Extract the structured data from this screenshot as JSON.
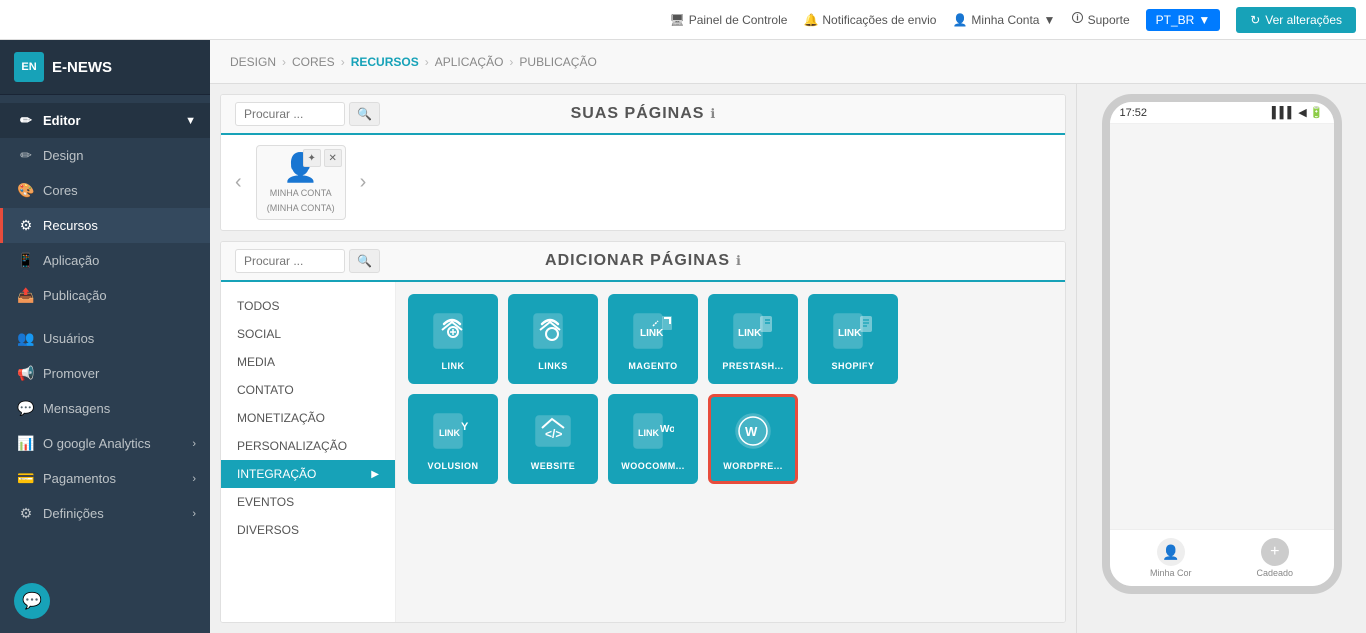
{
  "app": {
    "logo_text": "E-NEWS",
    "logo_icon": "EN"
  },
  "topbar": {
    "painel": "Painel de Controle",
    "notificacoes": "Notificações de envio",
    "minha_conta": "Minha Conta",
    "suporte": "Suporte",
    "lang": "PT_BR",
    "ver_alteracoes": "Ver alterações",
    "refresh_icon": "↻"
  },
  "breadcrumb": {
    "items": [
      "DESIGN",
      "CORES",
      "RECURSOS",
      "APLICAÇÃO",
      "PUBLICAÇÃO"
    ]
  },
  "sidebar": {
    "editor_label": "Editor",
    "items": [
      {
        "id": "design",
        "label": "Design",
        "icon": "✏"
      },
      {
        "id": "cores",
        "label": "Cores",
        "icon": "🎨"
      },
      {
        "id": "recursos",
        "label": "Recursos",
        "icon": "⚙",
        "active": true
      },
      {
        "id": "aplicacao",
        "label": "Aplicação",
        "icon": "📱"
      },
      {
        "id": "publicacao",
        "label": "Publicação",
        "icon": "📤"
      }
    ],
    "sections": [
      {
        "id": "usuarios",
        "label": "Usuários",
        "icon": "👥",
        "has_arrow": false
      },
      {
        "id": "promover",
        "label": "Promover",
        "icon": "📢",
        "has_arrow": false
      },
      {
        "id": "mensagens",
        "label": "Mensagens",
        "icon": "💬",
        "has_arrow": false
      },
      {
        "id": "analytics",
        "label": "O google Analytics",
        "icon": "📊",
        "has_arrow": true
      },
      {
        "id": "pagamentos",
        "label": "Pagamentos",
        "icon": "💳",
        "has_arrow": true
      },
      {
        "id": "definicoes",
        "label": "Definições",
        "icon": "⚙",
        "has_arrow": true
      }
    ]
  },
  "suas_paginas": {
    "title": "SUAS PÁGINAS",
    "search_placeholder": "Procurar ...",
    "search_btn": "🔍",
    "page_card": {
      "icon": "👤",
      "label": "MINHA CONTA",
      "sublabel": "(MINHA CONTA)"
    }
  },
  "adicionar_paginas": {
    "title": "ADICIONAR PÁGINAS",
    "search_placeholder": "Procurar ...",
    "search_btn": "🔍",
    "categories": [
      {
        "id": "todos",
        "label": "TODOS"
      },
      {
        "id": "social",
        "label": "SOCIAL"
      },
      {
        "id": "media",
        "label": "MEDIA"
      },
      {
        "id": "contato",
        "label": "CONTATO"
      },
      {
        "id": "monetizacao",
        "label": "MONETIZAÇÃO"
      },
      {
        "id": "personalizacao",
        "label": "PERSONALIZAÇÃO"
      },
      {
        "id": "integracao",
        "label": "INTEGRAÇÃO",
        "active": true
      },
      {
        "id": "eventos",
        "label": "EVENTOS"
      },
      {
        "id": "diversos",
        "label": "DIVERSOS"
      }
    ],
    "tiles_row1": [
      {
        "id": "link",
        "label": "LINK",
        "selected": false
      },
      {
        "id": "links",
        "label": "LINKS",
        "selected": false
      },
      {
        "id": "magento",
        "label": "MAGENTO",
        "selected": false
      },
      {
        "id": "prestash",
        "label": "PRESTASH...",
        "selected": false
      },
      {
        "id": "shopify",
        "label": "SHOPIFY",
        "selected": false
      }
    ],
    "tiles_row2": [
      {
        "id": "volusion",
        "label": "VOLUSION",
        "selected": false
      },
      {
        "id": "website",
        "label": "WEBSITE",
        "selected": false
      },
      {
        "id": "woocomm",
        "label": "WOOCOMM...",
        "selected": false
      },
      {
        "id": "wordpress",
        "label": "WORDPRE...",
        "selected": true
      }
    ]
  },
  "phone": {
    "time": "17:52",
    "signal": "▌▌▌",
    "wifi": "◀",
    "battery": "🔋",
    "bottom_items": [
      {
        "label": "Minha Cor",
        "icon": "👤"
      },
      {
        "label": "Cadeado",
        "icon": "+"
      }
    ]
  }
}
